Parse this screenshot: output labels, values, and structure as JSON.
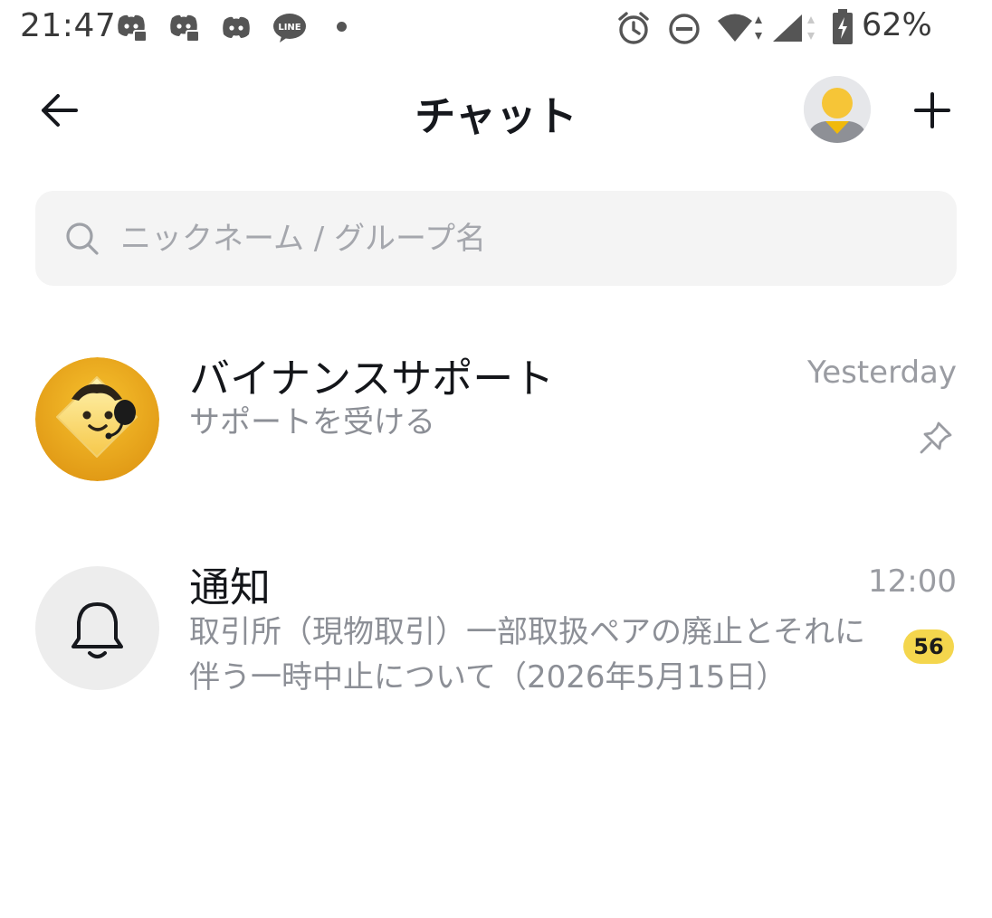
{
  "status_bar": {
    "time": "21:47",
    "notification_icons": [
      "discord-icon",
      "discord-icon",
      "discord-icon",
      "line-icon"
    ],
    "line_label": "LINE",
    "system_icons": [
      "alarm-icon",
      "dnd-icon",
      "wifi-icon",
      "cell-signal-icon",
      "battery-icon"
    ],
    "battery": "62%"
  },
  "header": {
    "title": "チャット",
    "back_icon": "arrow-left-icon",
    "add_icon": "plus-icon"
  },
  "search": {
    "placeholder": "ニックネーム / グループ名",
    "value": ""
  },
  "chats": [
    {
      "name": "バイナンスサポート",
      "preview": "サポートを受ける",
      "time": "Yesterday",
      "pinned": true,
      "avatar_icon": "support-mascot-icon"
    },
    {
      "name": "通知",
      "preview": "取引所（現物取引）一部取扱ペアの廃止とそれに伴う一時中止について（2026年5月15日）",
      "time": "12:00",
      "unread": "56",
      "avatar_icon": "bell-icon"
    }
  ],
  "colors": {
    "accent": "#f0b90b",
    "badge": "#f4d64d",
    "search_bg": "#f4f4f4",
    "muted_text": "#8c8f96"
  }
}
